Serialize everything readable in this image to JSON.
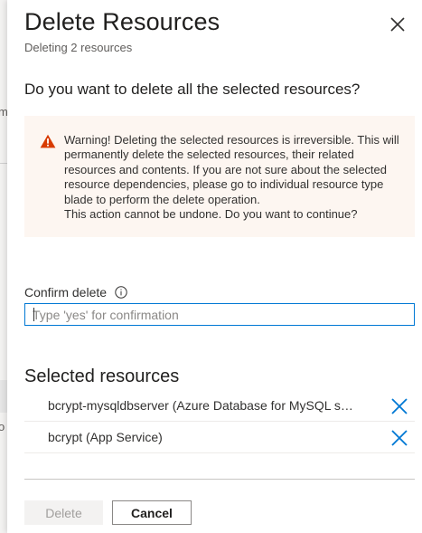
{
  "backdrop": {
    "peek_top": "m",
    "peek_bottom": "o"
  },
  "dialog": {
    "title": "Delete Resources",
    "subtitle": "Deleting 2 resources",
    "close_icon": "close-icon",
    "question": "Do you want to delete all the selected resources?"
  },
  "warning": {
    "icon": "warning-triangle-icon",
    "color": "#d83b01",
    "background": "#fdf6f1",
    "text": "Warning! Deleting the selected resources is irreversible. This will permanently delete the selected resources, their related resources and contents. If you are not sure about the selected resource dependencies, please go to individual resource type blade to perform the delete operation.\nThis action cannot be undone. Do you want to continue?"
  },
  "confirm": {
    "label": "Confirm delete",
    "info_icon": "info-icon",
    "value": "",
    "placeholder": "Type 'yes' for confirmation"
  },
  "selected_resources": {
    "title": "Selected resources",
    "items": [
      {
        "label": "bcrypt-mysqldbserver  (Azure Database for MySQL s…",
        "remove_icon": "remove-x-icon"
      },
      {
        "label": "bcrypt  (App Service)",
        "remove_icon": "remove-x-icon"
      }
    ]
  },
  "footer": {
    "delete_label": "Delete",
    "delete_enabled": false,
    "cancel_label": "Cancel"
  },
  "colors": {
    "accent": "#0078d4",
    "text": "#323130",
    "disabled_text": "#a19f9d"
  }
}
